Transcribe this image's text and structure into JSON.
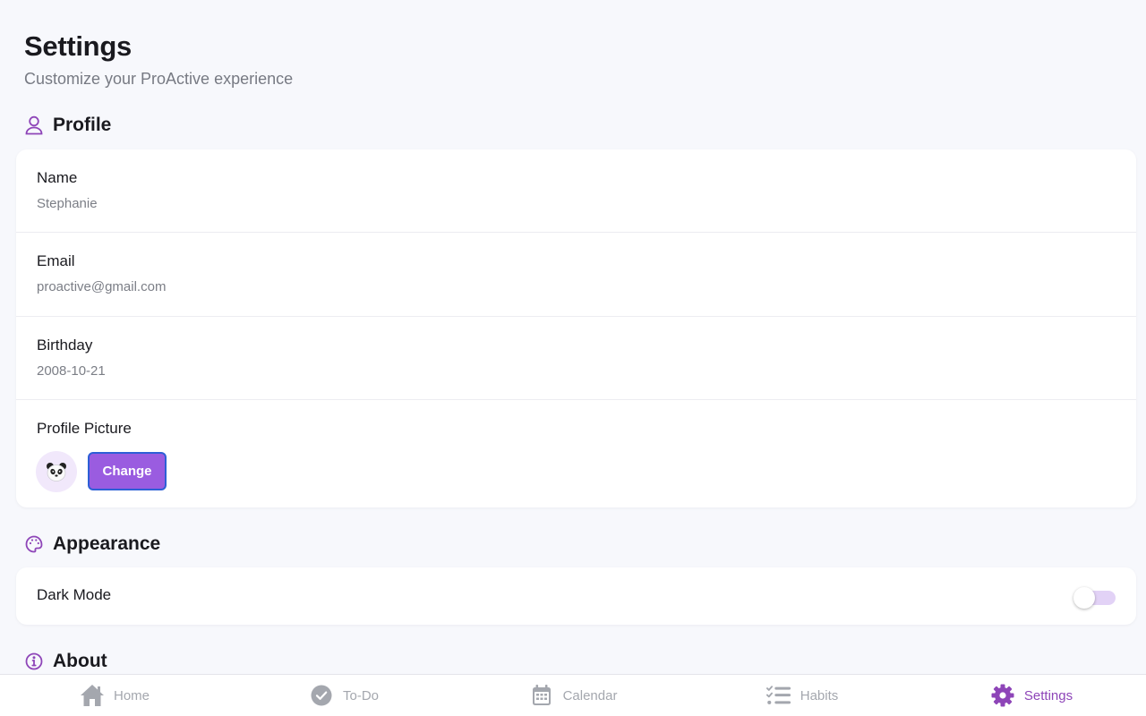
{
  "header": {
    "title": "Settings",
    "subtitle": "Customize your ProActive experience"
  },
  "profile": {
    "heading": "Profile",
    "fields": [
      {
        "label": "Name",
        "value": "Stephanie"
      },
      {
        "label": "Email",
        "value": "proactive@gmail.com"
      },
      {
        "label": "Birthday",
        "value": "2008-10-21"
      }
    ],
    "picture": {
      "label": "Profile Picture",
      "avatar": "🐼",
      "change_label": "Change"
    }
  },
  "appearance": {
    "heading": "Appearance",
    "dark_mode": {
      "label": "Dark Mode",
      "enabled": false
    }
  },
  "about": {
    "heading": "About"
  },
  "tabbar": {
    "items": [
      {
        "label": "Home",
        "icon": "home-icon",
        "active": false
      },
      {
        "label": "To-Do",
        "icon": "check-circle-icon",
        "active": false
      },
      {
        "label": "Calendar",
        "icon": "calendar-icon",
        "active": false
      },
      {
        "label": "Habits",
        "icon": "checklist-icon",
        "active": false
      },
      {
        "label": "Settings",
        "icon": "gear-icon",
        "active": true
      }
    ]
  },
  "colors": {
    "accent": "#8e45b8",
    "button": "#9a5ce0",
    "background": "#f7f8fc",
    "inactive": "#a4a7ae"
  }
}
